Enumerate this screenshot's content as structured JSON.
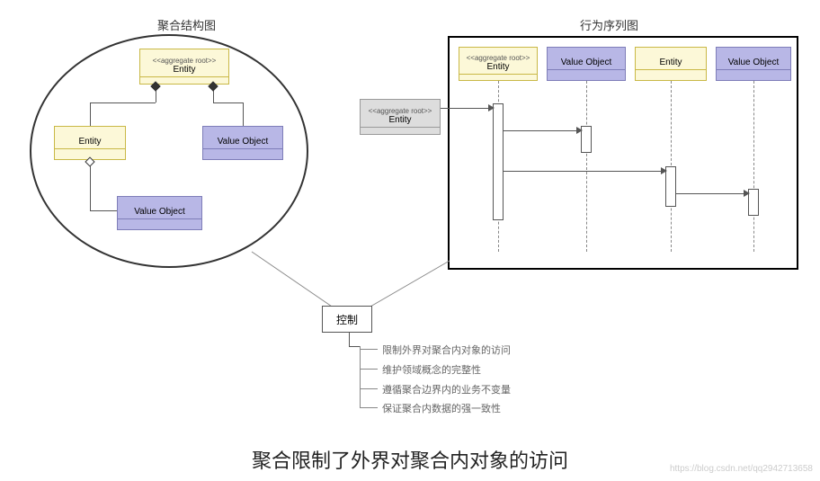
{
  "titles": {
    "left": "聚合结构图",
    "right": "行为序列图"
  },
  "structure": {
    "root": {
      "stereo": "<<aggregate root>>",
      "name": "Entity"
    },
    "entity": {
      "name": "Entity"
    },
    "vo1": {
      "name": "Value Object"
    },
    "vo2": {
      "name": "Value Object"
    }
  },
  "externalEntity": {
    "stereo": "<<aggregate root>>",
    "name": "Entity"
  },
  "sequence": {
    "p1": {
      "stereo": "<<aggregate root>>",
      "name": "Entity"
    },
    "p2": {
      "name": "Value Object"
    },
    "p3": {
      "name": "Entity"
    },
    "p4": {
      "name": "Value Object"
    }
  },
  "control": {
    "label": "控制",
    "bullets": [
      "限制外界对聚合内对象的访问",
      "维护领域概念的完整性",
      "遵循聚合边界内的业务不变量",
      "保证聚合内数据的强一致性"
    ]
  },
  "caption": "聚合限制了外界对聚合内对象的访问",
  "watermark": "https://blog.csdn.net/qq2942713658"
}
